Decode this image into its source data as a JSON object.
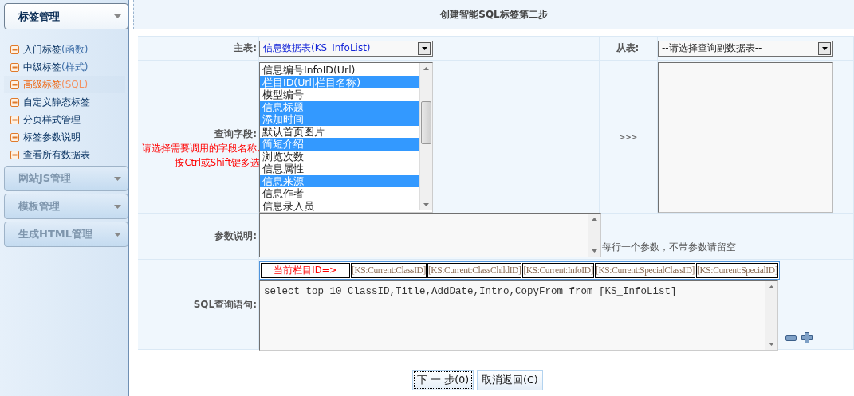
{
  "sidebar": {
    "sections": [
      {
        "title": "标签管理",
        "expanded": true,
        "items": [
          {
            "label": "入门标签",
            "note": "(函数)",
            "selected": false
          },
          {
            "label": "中级标签",
            "note": "(样式)",
            "selected": false
          },
          {
            "label": "高级标签",
            "note": "(SQL)",
            "selected": true
          },
          {
            "label": "自定义静态标签",
            "selected": false
          },
          {
            "label": "分页样式管理",
            "selected": false
          },
          {
            "label": "标签参数说明",
            "selected": false
          },
          {
            "label": "查看所有数据表",
            "selected": false
          }
        ]
      },
      {
        "title": "网站JS管理",
        "expanded": false
      },
      {
        "title": "模板管理",
        "expanded": false
      },
      {
        "title": "生成HTML管理",
        "expanded": false
      }
    ]
  },
  "page_title": "创建智能SQL标签第二步",
  "form": {
    "main_table": {
      "label": "主表:",
      "value": "信息数据表(KS_InfoList)"
    },
    "sub_table": {
      "label": "从表:",
      "value": "--请选择查询副数据表--"
    },
    "fields": {
      "label": "查询字段:",
      "hint_lines": [
        "请选择需要调用的字段名称,",
        "按Ctrl或Shift键多选"
      ],
      "options": [
        {
          "label": "信息编号InfoID(Url)",
          "selected": false
        },
        {
          "label": "栏目ID(Url|栏目名称)",
          "selected": true
        },
        {
          "label": "模型编号",
          "selected": false
        },
        {
          "label": "信息标题",
          "selected": true
        },
        {
          "label": "添加时间",
          "selected": true
        },
        {
          "label": "默认首页图片",
          "selected": false
        },
        {
          "label": "简短介绍",
          "selected": true
        },
        {
          "label": "浏览次数",
          "selected": false
        },
        {
          "label": "信息属性",
          "selected": false
        },
        {
          "label": "信息来源",
          "selected": true
        },
        {
          "label": "信息作者",
          "selected": false
        },
        {
          "label": "信息录入员",
          "selected": false
        }
      ]
    },
    "transfer": ">>>",
    "params": {
      "label": "参数说明:",
      "note": "每行一个参数，不带参数请留空"
    },
    "sql": {
      "label": "SQL查询语句:",
      "tags": [
        {
          "kind": "caption",
          "text": "当前栏目ID=>"
        },
        {
          "kind": "tag",
          "text": "[KS:Current:ClassID]"
        },
        {
          "kind": "tag",
          "text": "[KS:Current:ClassChildID]"
        },
        {
          "kind": "tag",
          "text": "[KS:Current:InfoID]"
        },
        {
          "kind": "tag",
          "text": "[KS:Current:SpecialClassID]"
        },
        {
          "kind": "tag",
          "text": "[KS:Current:SpecialID]"
        }
      ],
      "value": "select top 10 ClassID,Title,AddDate,Intro,CopyFrom from [KS_InfoList]"
    }
  },
  "buttons": [
    "下 一 步(0)",
    "取消返回(C)"
  ]
}
